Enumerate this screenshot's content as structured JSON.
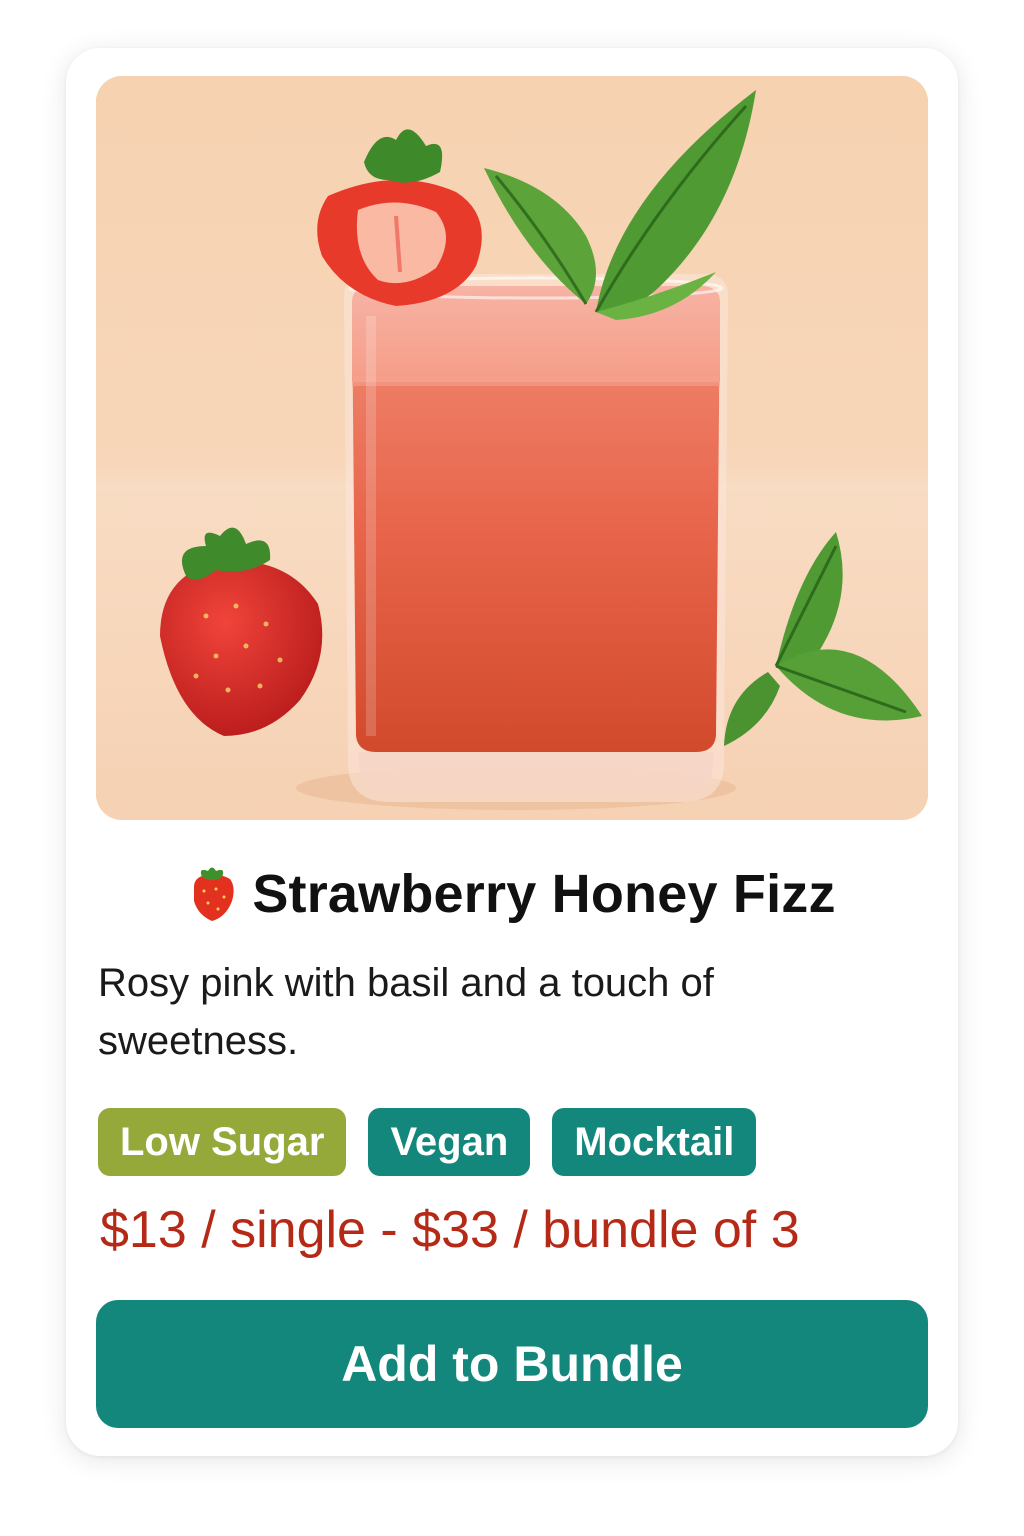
{
  "product": {
    "title": "Strawberry Honey Fizz",
    "title_icon": "strawberry-icon",
    "description": "Rosy pink with basil and a touch of sweetness.",
    "tags": [
      {
        "label": "Low Sugar",
        "color": "#95a83a"
      },
      {
        "label": "Vegan",
        "color": "#13877c"
      },
      {
        "label": "Mocktail",
        "color": "#13877c"
      }
    ],
    "price": "$13 / single - $33 / bundle of 3",
    "cta_label": "Add to Bundle"
  },
  "colors": {
    "accent": "#13877c",
    "price": "#b52a17",
    "hero_background": "#f5d3b5"
  }
}
